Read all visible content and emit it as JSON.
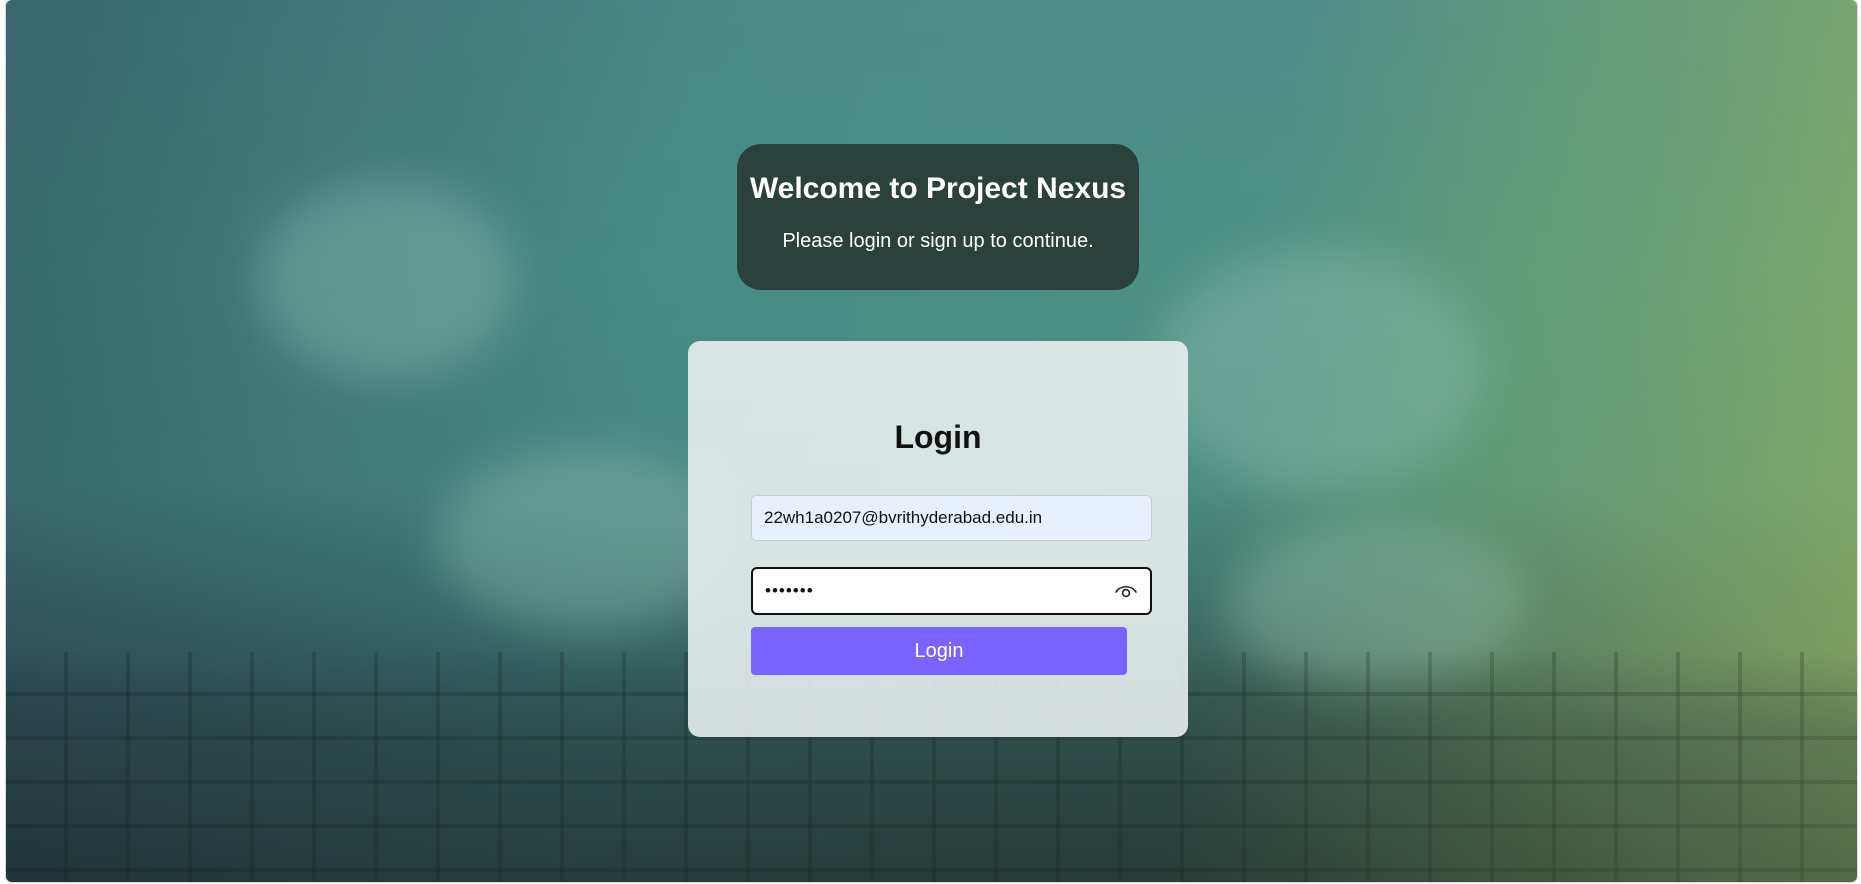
{
  "welcome": {
    "title": "Welcome to Project Nexus",
    "subtitle": "Please login or sign up to continue."
  },
  "login": {
    "title": "Login",
    "email_value": "22wh1a0207@bvrithyderabad.edu.in",
    "password_value": "•••••••",
    "password_toggle_icon": "eye-icon",
    "button_label": "Login"
  },
  "colors": {
    "welcome_card_bg": "#2a423b",
    "login_button_bg": "#7b63ff",
    "email_field_bg": "#e8f0fe"
  }
}
